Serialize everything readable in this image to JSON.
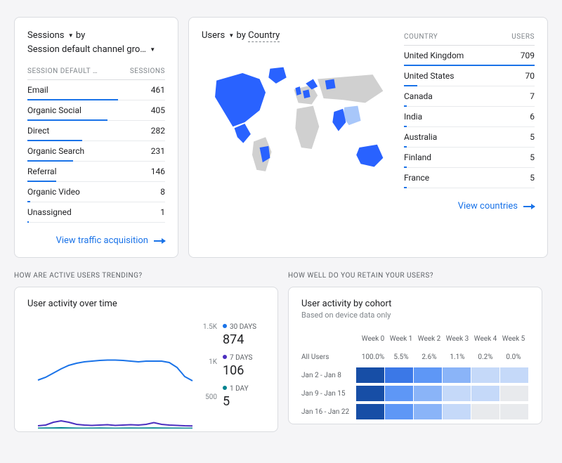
{
  "traffic": {
    "metric": "Sessions",
    "by": "by",
    "dimension": "Session default channel gro…",
    "col1": "SESSION DEFAULT …",
    "col2": "SESSIONS",
    "rows": [
      {
        "label": "Email",
        "value": "461",
        "bar": 66
      },
      {
        "label": "Organic Social",
        "value": "405",
        "bar": 58
      },
      {
        "label": "Direct",
        "value": "282",
        "bar": 40
      },
      {
        "label": "Organic Search",
        "value": "231",
        "bar": 33
      },
      {
        "label": "Referral",
        "value": "146",
        "bar": 21
      },
      {
        "label": "Organic Video",
        "value": "8",
        "bar": 2
      },
      {
        "label": "Unassigned",
        "value": "1",
        "bar": 1
      }
    ],
    "link": "View traffic acquisition"
  },
  "geo": {
    "metric": "Users",
    "by": "by",
    "dimension": "Country",
    "col1": "COUNTRY",
    "col2": "USERS",
    "rows": [
      {
        "label": "United Kingdom",
        "value": "709",
        "bar": 100
      },
      {
        "label": "United States",
        "value": "70",
        "bar": 10
      },
      {
        "label": "Canada",
        "value": "7",
        "bar": 2
      },
      {
        "label": "India",
        "value": "6",
        "bar": 2
      },
      {
        "label": "Australia",
        "value": "5",
        "bar": 2
      },
      {
        "label": "Finland",
        "value": "5",
        "bar": 2
      },
      {
        "label": "France",
        "value": "5",
        "bar": 2
      }
    ],
    "link": "View countries"
  },
  "trend": {
    "section": "HOW ARE ACTIVE USERS TRENDING?",
    "title": "User activity over time",
    "ylabels": [
      "1.5K",
      "1K",
      "500"
    ],
    "legend": [
      {
        "color": "#1a73e8",
        "label": "30 DAYS",
        "value": "874"
      },
      {
        "color": "#4c2fbf",
        "label": "7 DAYS",
        "value": "106"
      },
      {
        "color": "#00838f",
        "label": "1 DAY",
        "value": "5"
      }
    ]
  },
  "retain": {
    "section": "HOW WELL DO YOU RETAIN YOUR USERS?",
    "title": "User activity by cohort",
    "sub": "Based on device data only",
    "weeks": [
      "Week 0",
      "Week 1",
      "Week 2",
      "Week 3",
      "Week 4",
      "Week 5"
    ],
    "all_label": "All Users",
    "pct": [
      "100.0%",
      "5.5%",
      "2.6%",
      "1.1%",
      "0.2%",
      "0.0%"
    ],
    "cohorts": [
      {
        "label": "Jan 2 - Jan 8",
        "shades": [
          5,
          4,
          3,
          2,
          1,
          1
        ]
      },
      {
        "label": "Jan 9 - Jan 15",
        "shades": [
          5,
          3,
          2,
          1,
          1,
          0
        ]
      },
      {
        "label": "Jan 16 - Jan 22",
        "shades": [
          5,
          3,
          2,
          1,
          0,
          0
        ]
      }
    ]
  },
  "chart_data": {
    "type": "line",
    "title": "User activity over time",
    "ylim": [
      0,
      1500
    ],
    "series": [
      {
        "name": "30 DAYS",
        "color": "#1a73e8",
        "values": [
          690,
          730,
          790,
          850,
          900,
          930,
          950,
          960,
          970,
          975,
          975,
          970,
          960,
          950,
          960,
          960,
          960,
          940,
          870,
          740,
          680
        ]
      },
      {
        "name": "7 DAYS",
        "color": "#4c2fbf",
        "values": [
          40,
          50,
          90,
          110,
          90,
          60,
          50,
          45,
          50,
          55,
          45,
          50,
          55,
          50,
          60,
          85,
          60,
          50,
          45,
          40,
          38
        ]
      },
      {
        "name": "1 DAY",
        "color": "#00838f",
        "values": [
          5,
          6,
          8,
          10,
          7,
          5,
          4,
          5,
          6,
          5,
          4,
          5,
          6,
          5,
          6,
          8,
          6,
          5,
          5,
          4,
          4
        ]
      }
    ]
  }
}
